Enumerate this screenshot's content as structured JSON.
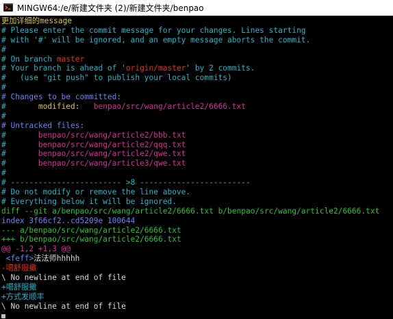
{
  "window": {
    "title": "MINGW64:/e/新建文件夹 (2)/新建文件夹/benpao",
    "app_icon": "mingw-git-icon"
  },
  "lines": [
    [
      {
        "t": "更加详细的message",
        "c": "c-yellow"
      }
    ],
    [
      {
        "t": "# Please enter the commit message for your changes. Lines starting",
        "c": "c-cyan"
      }
    ],
    [
      {
        "t": "# with '#' will be ignored, and an empty message aborts the commit.",
        "c": "c-cyan"
      }
    ],
    [
      {
        "t": "#",
        "c": "c-cyan"
      }
    ],
    [
      {
        "t": "# On branch ",
        "c": "c-cyan"
      },
      {
        "t": "master",
        "c": "c-red"
      }
    ],
    [
      {
        "t": "# Your branch is ahead of '",
        "c": "c-cyan"
      },
      {
        "t": "origin/master",
        "c": "c-red"
      },
      {
        "t": "' by 2 commits.",
        "c": "c-cyan"
      }
    ],
    [
      {
        "t": "#   (use \"git push\" to publish your local commits)",
        "c": "c-cyan"
      }
    ],
    [
      {
        "t": "#",
        "c": "c-cyan"
      }
    ],
    [
      {
        "t": "# Changes to be committed:",
        "c": "c-blue"
      }
    ],
    [
      {
        "t": "#",
        "c": "c-cyan"
      },
      {
        "t": "       modified:   ",
        "c": "c-yellow"
      },
      {
        "t": "benpao/src/wang/article2/6666.txt",
        "c": "c-pink"
      }
    ],
    [
      {
        "t": "#",
        "c": "c-cyan"
      }
    ],
    [
      {
        "t": "# Untracked files:",
        "c": "c-blue"
      }
    ],
    [
      {
        "t": "#",
        "c": "c-cyan"
      },
      {
        "t": "       benpao/src/wang/article2/bbb.txt",
        "c": "c-pink"
      }
    ],
    [
      {
        "t": "#",
        "c": "c-cyan"
      },
      {
        "t": "       benpao/src/wang/article2/qqq.txt",
        "c": "c-pink"
      }
    ],
    [
      {
        "t": "#",
        "c": "c-cyan"
      },
      {
        "t": "       benpao/src/wang/article2/qwe.txt",
        "c": "c-pink"
      }
    ],
    [
      {
        "t": "#",
        "c": "c-cyan"
      },
      {
        "t": "       benpao/src/wang/article3/qwe.txt",
        "c": "c-pink"
      }
    ],
    [
      {
        "t": "#",
        "c": "c-cyan"
      }
    ],
    [
      {
        "t": "# ------------------------ >8 ------------------------",
        "c": "c-cyan"
      }
    ],
    [
      {
        "t": "# Do not modify or remove the line above.",
        "c": "c-cyan"
      }
    ],
    [
      {
        "t": "# Everything below it will be ignored.",
        "c": "c-cyan"
      }
    ],
    [
      {
        "t": "diff --git a/benpao/src/wang/article2/6666.txt b/benpao/src/wang/article2/6666.txt",
        "c": "c-green"
      }
    ],
    [
      {
        "t": "index 3f66cf2..cd5209e 100644",
        "c": "c-blue"
      }
    ],
    [
      {
        "t": "--- a/benpao/src/wang/article2/6666.txt",
        "c": "c-green"
      }
    ],
    [
      {
        "t": "+++ b/benpao/src/wang/article2/6666.txt",
        "c": "c-green"
      }
    ],
    [
      {
        "t": "@@ -1,2 +1,3 @@",
        "c": "c-pink"
      }
    ],
    [
      {
        "t": " ",
        "c": "c-white"
      },
      {
        "t": "<feff>",
        "c": "c-blue"
      },
      {
        "t": "法法师hhhhh",
        "c": "c-white"
      }
    ],
    [
      {
        "t": "-噶舒服撒",
        "c": "c-red"
      }
    ],
    [
      {
        "t": "\\ No newline at end of file",
        "c": "c-white"
      }
    ],
    [
      {
        "t": "+噶舒服撒",
        "c": "c-cyan"
      }
    ],
    [
      {
        "t": "+方式发顺丰",
        "c": "c-cyan"
      }
    ],
    [
      {
        "t": "\\ No newline at end of file",
        "c": "c-white"
      }
    ]
  ]
}
